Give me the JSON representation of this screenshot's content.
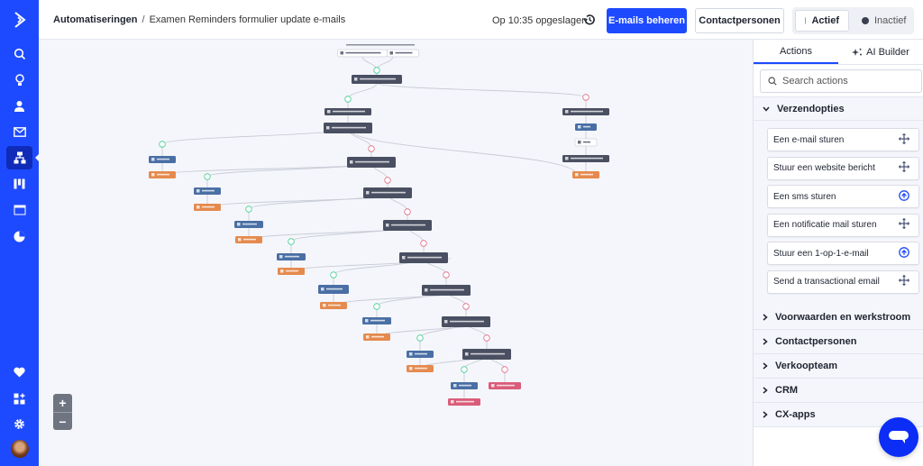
{
  "sidebar": {
    "logo": "activecampaign-logo-icon",
    "items": [
      {
        "icon": "search-icon",
        "label": "Zoeken"
      },
      {
        "icon": "lightbulb-icon",
        "label": "Ideeën"
      },
      {
        "icon": "contact-icon",
        "label": "Contactpersonen"
      },
      {
        "icon": "mail-icon",
        "label": "Campagnes"
      },
      {
        "icon": "automation-icon",
        "label": "Automatiseringen",
        "active": true
      },
      {
        "icon": "pipeline-icon",
        "label": "Deals"
      },
      {
        "icon": "website-icon",
        "label": "Website"
      },
      {
        "icon": "reports-icon",
        "label": "Rapporten"
      }
    ],
    "bottom_items": [
      {
        "icon": "heart-icon"
      },
      {
        "icon": "apps-add-icon"
      },
      {
        "icon": "gear-icon"
      }
    ]
  },
  "header": {
    "breadcrumb_root": "Automatiseringen",
    "breadcrumb_sep": "/",
    "breadcrumb_current": "Examen Reminders formulier update e-mails",
    "saved_text": "Op 10:35 opgeslagen",
    "history_icon": "history-icon",
    "manage_emails_label": "E-mails beheren",
    "contacts_label": "Contactpersonen",
    "status_active_label": "Actief",
    "status_inactive_label": "Inactief",
    "status_selected": "Actief",
    "colors": {
      "primary": "#1e4aff",
      "active_dot": "#3ecf8e",
      "inactive_dot": "#3b4050"
    }
  },
  "canvas": {
    "zoom_in_label": "+",
    "zoom_out_label": "−",
    "node_colors": {
      "trigger": "#ffffff",
      "condition": "#4a5062",
      "contact": "#4a6fa5",
      "task": "#e58a4e",
      "wait": "#ffffff",
      "end": "#d95d7a",
      "yes": "#3ecf8e",
      "no": "#e06a80"
    }
  },
  "panel": {
    "tab_actions": "Actions",
    "tab_ai_builder": "AI Builder",
    "search_placeholder": "Search actions",
    "open_section": "Verzendopties",
    "actions": [
      {
        "label": "Een e-mail sturen",
        "icon": "move-icon"
      },
      {
        "label": "Stuur een website bericht",
        "icon": "move-icon"
      },
      {
        "label": "Een sms sturen",
        "icon": "upgrade-icon"
      },
      {
        "label": "Een notificatie mail sturen",
        "icon": "move-icon"
      },
      {
        "label": "Stuur een 1-op-1-e-mail",
        "icon": "upgrade-icon"
      },
      {
        "label": "Send a transactional email",
        "icon": "move-icon"
      }
    ],
    "collapsed_sections": [
      "Voorwaarden en werkstroom",
      "Contactpersonen",
      "Verkoopteam",
      "CRM",
      "CX-apps"
    ]
  },
  "chat": {
    "icon": "chat-icon"
  }
}
